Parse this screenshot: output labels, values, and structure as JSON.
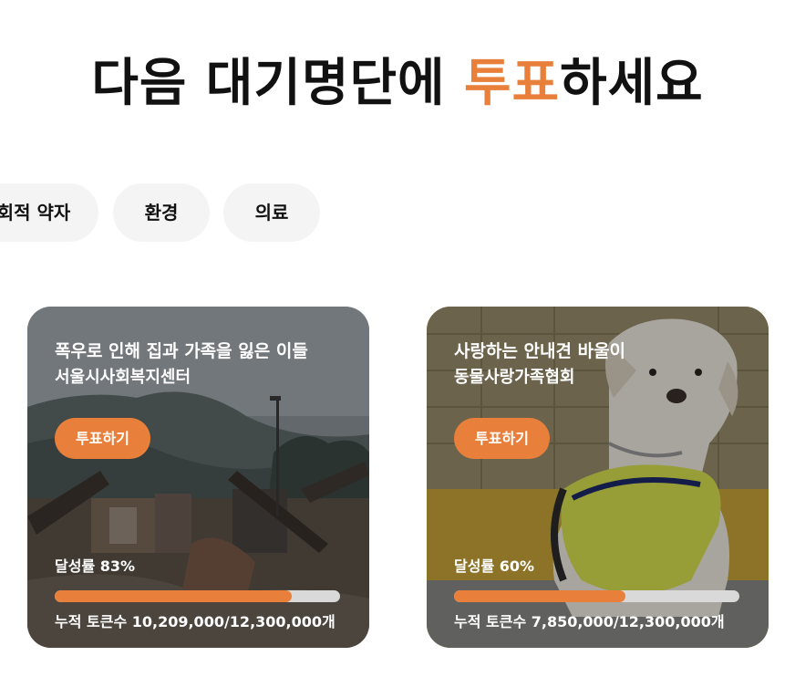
{
  "header": {
    "title_prefix": "다음 대기명단에 ",
    "title_accent": "투표",
    "title_suffix": "하세요"
  },
  "categories": [
    {
      "label": "회적 약자"
    },
    {
      "label": "환경"
    },
    {
      "label": "의료"
    }
  ],
  "cards": [
    {
      "title": "폭우로 인해 집과 가족을 잃은 이들",
      "organization": "서울시사회복지센터",
      "vote_label": "투표하기",
      "rate_label": "달성률 83%",
      "rate_value": 83,
      "tokens_label": "누적 토큰수 10,209,000/12,300,000개",
      "image": "flood-damaged-houses-photo"
    },
    {
      "title": "사랑하는 안내견 바울이",
      "organization": "동물사랑가족협회",
      "vote_label": "투표하기",
      "rate_label": "달성률 60%",
      "rate_value": 60,
      "tokens_label": "누적 토큰수 7,850,000/12,300,000개",
      "image": "guide-dog-labrador-photo"
    }
  ],
  "colors": {
    "accent": "#e8803c",
    "chip_bg": "#f4f4f4",
    "progress_track": "#d9d9d9"
  }
}
